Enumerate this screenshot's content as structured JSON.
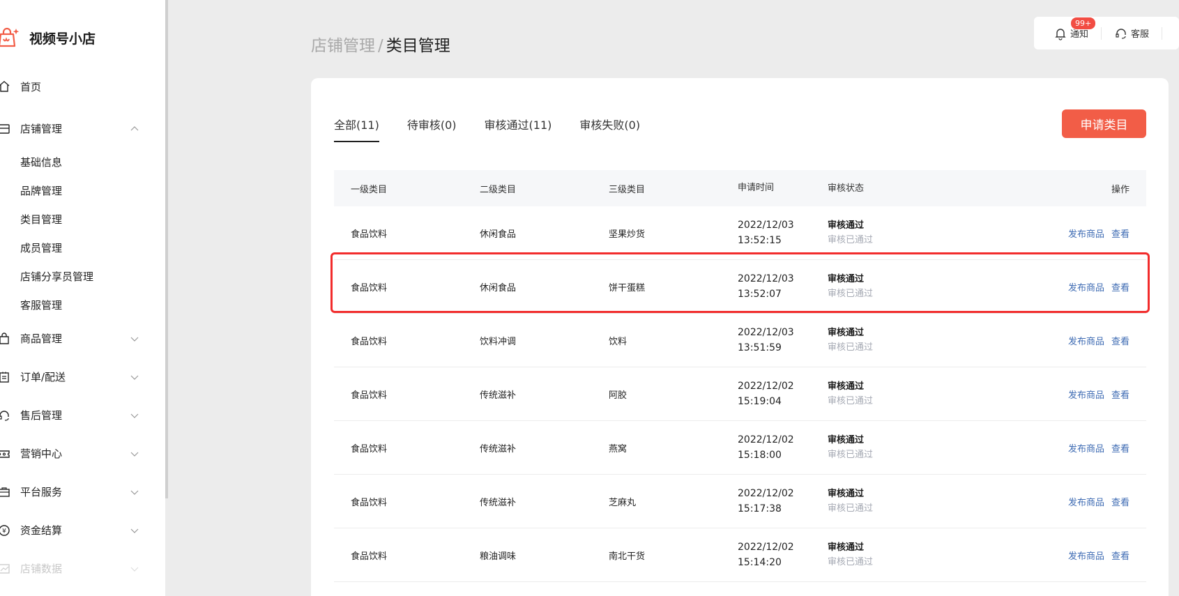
{
  "brand": {
    "name": "视频号小店"
  },
  "sidebar": {
    "home": "首页",
    "store_mgmt": "店铺管理",
    "store_sub": [
      "基础信息",
      "品牌管理",
      "类目管理",
      "成员管理",
      "店铺分享员管理",
      "客服管理"
    ],
    "goods": "商品管理",
    "orders": "订单/配送",
    "aftersale": "售后管理",
    "marketing": "营销中心",
    "platform": "平台服务",
    "finance": "资金结算",
    "data": "店铺数据"
  },
  "breadcrumb": {
    "parent": "店铺管理",
    "separator": "/",
    "current": "类目管理"
  },
  "topbar": {
    "notify_label": "通知",
    "notify_badge": "99+",
    "service_label": "客服"
  },
  "tabs": [
    "全部(11)",
    "待审核(0)",
    "审核通过(11)",
    "审核失败(0)"
  ],
  "apply_button": "申请类目",
  "table": {
    "headers": {
      "c1": "一级类目",
      "c2": "二级类目",
      "c3": "三级类目",
      "c4": "申请时间",
      "c5": "审核状态",
      "c6": "操作"
    },
    "rows": [
      {
        "c1": "食品饮料",
        "c2": "休闲食品",
        "c3": "坚果炒货",
        "date": "2022/12/03",
        "time": "13:52:15",
        "status": "审核通过",
        "status_sub": "审核已通过",
        "op1": "发布商品",
        "op2": "查看"
      },
      {
        "c1": "食品饮料",
        "c2": "休闲食品",
        "c3": "饼干蛋糕",
        "date": "2022/12/03",
        "time": "13:52:07",
        "status": "审核通过",
        "status_sub": "审核已通过",
        "op1": "发布商品",
        "op2": "查看"
      },
      {
        "c1": "食品饮料",
        "c2": "饮料冲调",
        "c3": "饮料",
        "date": "2022/12/03",
        "time": "13:51:59",
        "status": "审核通过",
        "status_sub": "审核已通过",
        "op1": "发布商品",
        "op2": "查看"
      },
      {
        "c1": "食品饮料",
        "c2": "传统滋补",
        "c3": "阿胶",
        "date": "2022/12/02",
        "time": "15:19:04",
        "status": "审核通过",
        "status_sub": "审核已通过",
        "op1": "发布商品",
        "op2": "查看"
      },
      {
        "c1": "食品饮料",
        "c2": "传统滋补",
        "c3": "燕窝",
        "date": "2022/12/02",
        "time": "15:18:00",
        "status": "审核通过",
        "status_sub": "审核已通过",
        "op1": "发布商品",
        "op2": "查看"
      },
      {
        "c1": "食品饮料",
        "c2": "传统滋补",
        "c3": "芝麻丸",
        "date": "2022/12/02",
        "time": "15:17:38",
        "status": "审核通过",
        "status_sub": "审核已通过",
        "op1": "发布商品",
        "op2": "查看"
      },
      {
        "c1": "食品饮料",
        "c2": "粮油调味",
        "c3": "南北干货",
        "date": "2022/12/02",
        "time": "15:14:20",
        "status": "审核通过",
        "status_sub": "审核已通过",
        "op1": "发布商品",
        "op2": "查看"
      }
    ]
  },
  "colors": {
    "accent": "#f25d47",
    "link": "#3e6bb3",
    "highlight": "#f22c2c"
  }
}
